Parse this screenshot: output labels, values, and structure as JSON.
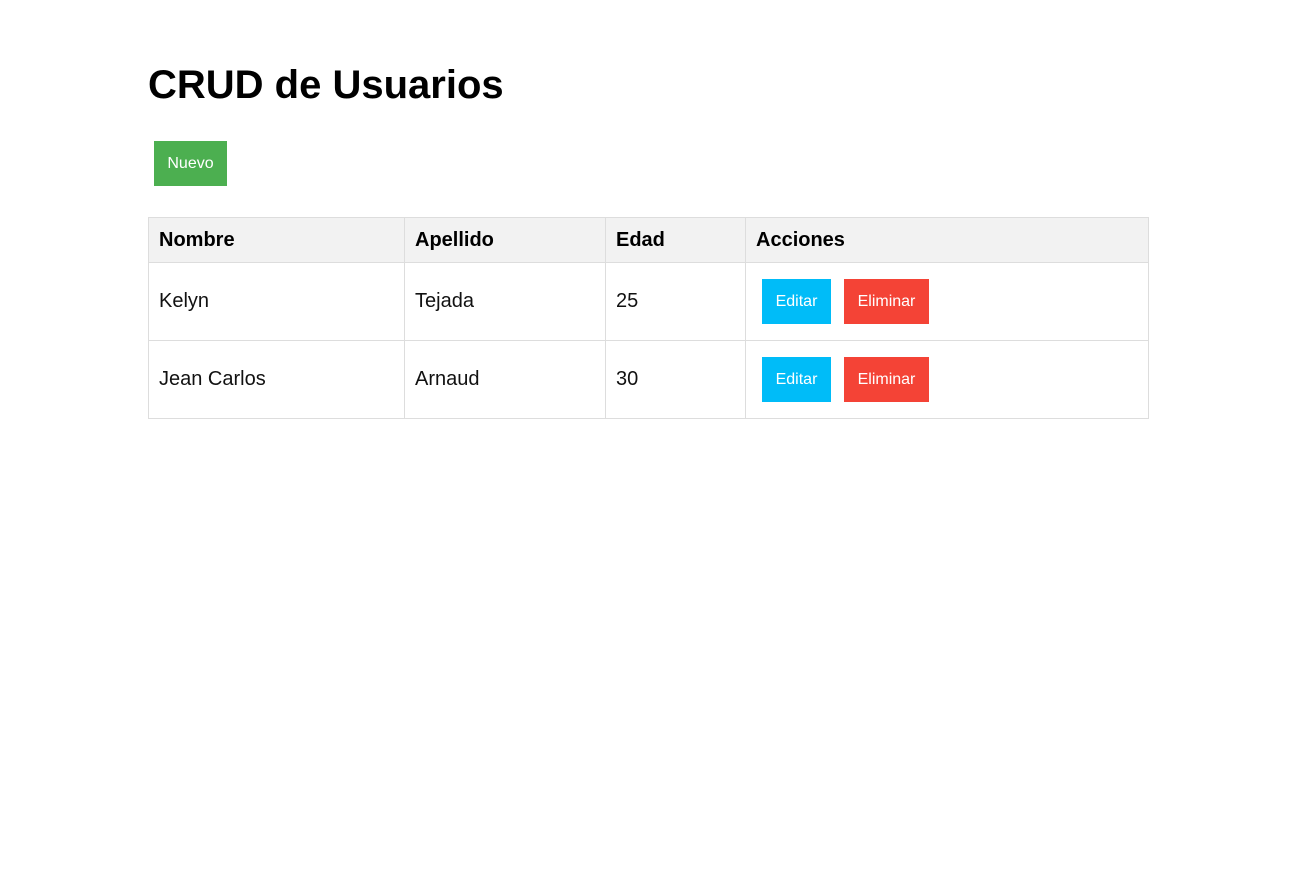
{
  "page": {
    "title": "CRUD de Usuarios"
  },
  "toolbar": {
    "new_label": "Nuevo"
  },
  "colors": {
    "new": "#4caf50",
    "edit": "#00bcf8",
    "delete": "#f44336",
    "header_bg": "#f2f2f2",
    "border": "#dddddd"
  },
  "table": {
    "headers": [
      "Nombre",
      "Apellido",
      "Edad",
      "Acciones"
    ],
    "rows": [
      {
        "nombre": "Kelyn",
        "apellido": "Tejada",
        "edad": "25",
        "edit_label": "Editar",
        "delete_label": "Eliminar"
      },
      {
        "nombre": "Jean Carlos",
        "apellido": "Arnaud",
        "edad": "30",
        "edit_label": "Editar",
        "delete_label": "Eliminar"
      }
    ]
  }
}
